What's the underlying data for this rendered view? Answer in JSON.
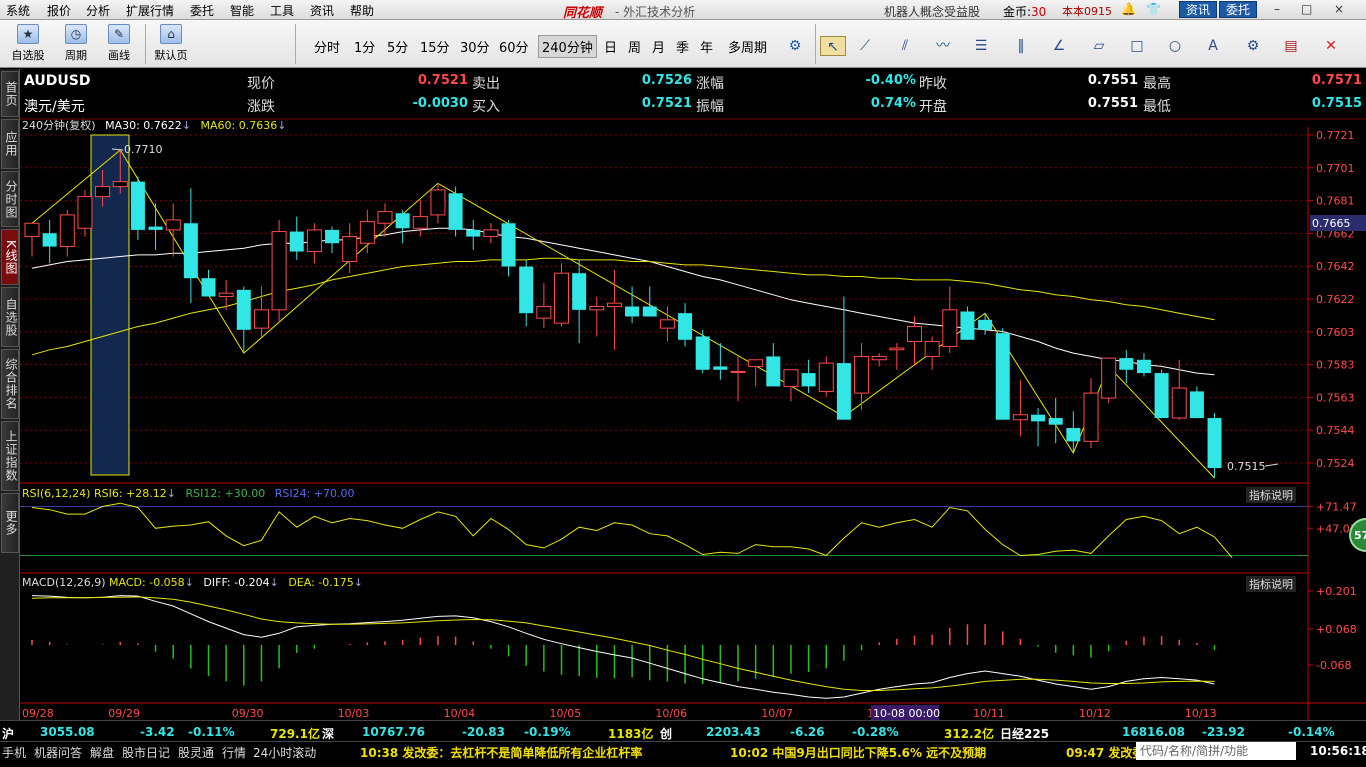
{
  "menu": {
    "items": [
      "系统",
      "报价",
      "分析",
      "扩展行情",
      "委托",
      "智能",
      "工具",
      "资讯",
      "帮助"
    ],
    "brand": "同花顺",
    "subtitle": "- 外汇技术分析",
    "promo": "机器人概念受益股",
    "coins_label": "金币:",
    "coins_value": "30",
    "user": "本本0915",
    "btn_news": "资讯",
    "btn_trade": "委托",
    "win_min": "–",
    "win_max": "□",
    "win_close": "×"
  },
  "toolbar": {
    "btn_watchlist": "自选股",
    "btn_cycle": "周期",
    "btn_draw": "画线",
    "btn_default": "默认页",
    "periods": [
      "分时",
      "1分",
      "5分",
      "15分",
      "30分",
      "60分",
      "240分钟",
      "日",
      "周",
      "月",
      "季",
      "年",
      "多周期"
    ],
    "active_period": "240分钟"
  },
  "sidetabs": [
    "首页",
    "应用",
    "分时图",
    "K线图",
    "自选股",
    "综合排名",
    "上证指数",
    "更多"
  ],
  "quote": {
    "symbol": "AUDUSD",
    "name": "澳元/美元",
    "now_label": "现价",
    "now": "0.7521",
    "sell_label": "卖出",
    "sell": "0.7526",
    "pct_label": "涨幅",
    "pct": "-0.40%",
    "prev_label": "昨收",
    "prev": "0.7551",
    "high_label": "最高",
    "high": "0.7571",
    "chg_label": "涨跌",
    "chg": "-0.0030",
    "buy_label": "买入",
    "buy": "0.7521",
    "amp_label": "振幅",
    "amp": "0.74%",
    "open_label": "开盘",
    "open": "0.7551",
    "low_label": "最低",
    "low": "0.7515"
  },
  "main_legend": {
    "period": "240分钟(复权)",
    "ma30": "MA30: 0.7622",
    "ma60": "MA60: 0.7636"
  },
  "rsi_legend": {
    "title": "RSI(6,12,24)",
    "rsi6": "RSI6: +28.12",
    "rsi12": "RSI12: +30.00",
    "rsi24": "RSI24: +70.00",
    "help": "指标说明"
  },
  "macd_legend": {
    "title": "MACD(12,26,9)",
    "macd": "MACD: -0.058",
    "diff": "DIFF: -0.204",
    "dea": "DEA: -0.175",
    "help": "指标说明"
  },
  "annotations": {
    "high_mark": "0.7710",
    "low_mark": "0.7515",
    "cursor_time": "10-08 00:00",
    "current_price": "0.7665",
    "badge": "57"
  },
  "status": {
    "sh_label": "沪",
    "sh_val": "3055.08",
    "sh_chg": "-3.42",
    "sh_pct": "-0.11%",
    "sh_amt": "729.1亿",
    "sz_label": "深",
    "sz_val": "10767.76",
    "sz_chg": "-20.83",
    "sz_pct": "-0.19%",
    "sz_amt": "1183亿",
    "cy_label": "创",
    "cy_val": "2203.43",
    "cy_chg": "-6.26",
    "cy_pct": "-0.28%",
    "cy_amt": "312.2亿",
    "nk_label": "日经225",
    "nk_val": "16816.08",
    "nk_chg": "-23.92",
    "nk_pct": "-0.14%"
  },
  "ticker": {
    "buttons": [
      "手机",
      "机器问答",
      "解盘",
      "股市日记",
      "股灵通",
      "行情",
      "24小时滚动"
    ],
    "news1": "10:38 发改委：去杠杆不是简单降低所有企业杠杆率",
    "news2": "10:02 中国9月出口同比下降5.6% 远不及预期",
    "news3": "09:47 发改委",
    "search_placeholder": "代码/名称/简拼/功能",
    "clock": "10:56:18"
  },
  "colors": {
    "up": "#ff4a4a",
    "down": "#33e6e6",
    "ma30": "#ffffff",
    "ma60": "#e6e600",
    "grid": "#7a0000",
    "highlight": "#13284d"
  },
  "chart_data": {
    "type": "candlestick",
    "symbol": "AUDUSD",
    "period": "240分钟",
    "price_axis": [
      "0.7721",
      "0.7701",
      "0.7681",
      "0.7662",
      "0.7642",
      "0.7622",
      "0.7603",
      "0.7583",
      "0.7563",
      "0.7544",
      "0.7524"
    ],
    "ylim": [
      0.7515,
      0.7721
    ],
    "date_labels": [
      "09/28",
      "09/29",
      "09/30",
      "10/03",
      "10/04",
      "10/05",
      "10/06",
      "10/07",
      "10/10",
      "10/11",
      "10/12",
      "10/13"
    ],
    "date_label_index": [
      0,
      5,
      12,
      18,
      24,
      30,
      36,
      42,
      48,
      54,
      60,
      66
    ],
    "candles": [
      {
        "o": 0.766,
        "h": 0.7668,
        "l": 0.7648,
        "c": 0.7668
      },
      {
        "o": 0.7662,
        "h": 0.767,
        "l": 0.7644,
        "c": 0.7654
      },
      {
        "o": 0.7654,
        "h": 0.7676,
        "l": 0.7648,
        "c": 0.7673
      },
      {
        "o": 0.7665,
        "h": 0.7688,
        "l": 0.766,
        "c": 0.7684
      },
      {
        "o": 0.7684,
        "h": 0.77,
        "l": 0.7678,
        "c": 0.769
      },
      {
        "o": 0.769,
        "h": 0.7712,
        "l": 0.7686,
        "c": 0.7693
      },
      {
        "o": 0.7693,
        "h": 0.7696,
        "l": 0.7658,
        "c": 0.7664
      },
      {
        "o": 0.7666,
        "h": 0.768,
        "l": 0.7652,
        "c": 0.7664
      },
      {
        "o": 0.7664,
        "h": 0.768,
        "l": 0.7648,
        "c": 0.767
      },
      {
        "o": 0.7668,
        "h": 0.7689,
        "l": 0.762,
        "c": 0.7635
      },
      {
        "o": 0.7635,
        "h": 0.764,
        "l": 0.7628,
        "c": 0.7624
      },
      {
        "o": 0.7624,
        "h": 0.7634,
        "l": 0.7616,
        "c": 0.7626
      },
      {
        "o": 0.7628,
        "h": 0.763,
        "l": 0.759,
        "c": 0.7604
      },
      {
        "o": 0.7605,
        "h": 0.763,
        "l": 0.76,
        "c": 0.7616
      },
      {
        "o": 0.7616,
        "h": 0.767,
        "l": 0.7608,
        "c": 0.7663
      },
      {
        "o": 0.7663,
        "h": 0.7672,
        "l": 0.7646,
        "c": 0.7651
      },
      {
        "o": 0.7651,
        "h": 0.7668,
        "l": 0.7644,
        "c": 0.7664
      },
      {
        "o": 0.7664,
        "h": 0.7666,
        "l": 0.765,
        "c": 0.7656
      },
      {
        "o": 0.7645,
        "h": 0.7668,
        "l": 0.7638,
        "c": 0.766
      },
      {
        "o": 0.7656,
        "h": 0.7676,
        "l": 0.765,
        "c": 0.7669
      },
      {
        "o": 0.7668,
        "h": 0.768,
        "l": 0.766,
        "c": 0.7675
      },
      {
        "o": 0.7674,
        "h": 0.7676,
        "l": 0.7656,
        "c": 0.7665
      },
      {
        "o": 0.7665,
        "h": 0.7682,
        "l": 0.766,
        "c": 0.7672
      },
      {
        "o": 0.7673,
        "h": 0.7692,
        "l": 0.7668,
        "c": 0.7688
      },
      {
        "o": 0.7686,
        "h": 0.769,
        "l": 0.766,
        "c": 0.7664
      },
      {
        "o": 0.7664,
        "h": 0.767,
        "l": 0.7652,
        "c": 0.766
      },
      {
        "o": 0.766,
        "h": 0.7668,
        "l": 0.7656,
        "c": 0.7664
      },
      {
        "o": 0.7668,
        "h": 0.767,
        "l": 0.7636,
        "c": 0.7642
      },
      {
        "o": 0.7642,
        "h": 0.7646,
        "l": 0.7606,
        "c": 0.7614
      },
      {
        "o": 0.7611,
        "h": 0.7632,
        "l": 0.7605,
        "c": 0.7618
      },
      {
        "o": 0.7608,
        "h": 0.7644,
        "l": 0.7606,
        "c": 0.7638
      },
      {
        "o": 0.7638,
        "h": 0.7646,
        "l": 0.7596,
        "c": 0.7616
      },
      {
        "o": 0.7616,
        "h": 0.7624,
        "l": 0.76,
        "c": 0.7618
      },
      {
        "o": 0.7618,
        "h": 0.764,
        "l": 0.7592,
        "c": 0.762
      },
      {
        "o": 0.7618,
        "h": 0.763,
        "l": 0.7608,
        "c": 0.7612
      },
      {
        "o": 0.7618,
        "h": 0.763,
        "l": 0.7612,
        "c": 0.7612
      },
      {
        "o": 0.7605,
        "h": 0.7618,
        "l": 0.7597,
        "c": 0.761
      },
      {
        "o": 0.7614,
        "h": 0.762,
        "l": 0.7594,
        "c": 0.7598
      },
      {
        "o": 0.76,
        "h": 0.7604,
        "l": 0.7578,
        "c": 0.758
      },
      {
        "o": 0.7582,
        "h": 0.7596,
        "l": 0.7574,
        "c": 0.758
      },
      {
        "o": 0.7579,
        "h": 0.7588,
        "l": 0.7561,
        "c": 0.7579
      },
      {
        "o": 0.7582,
        "h": 0.7584,
        "l": 0.757,
        "c": 0.7586
      },
      {
        "o": 0.7588,
        "h": 0.7596,
        "l": 0.7572,
        "c": 0.757
      },
      {
        "o": 0.757,
        "h": 0.758,
        "l": 0.7561,
        "c": 0.758
      },
      {
        "o": 0.7578,
        "h": 0.7586,
        "l": 0.7566,
        "c": 0.757
      },
      {
        "o": 0.7567,
        "h": 0.7588,
        "l": 0.7564,
        "c": 0.7584
      },
      {
        "o": 0.7584,
        "h": 0.7624,
        "l": 0.7552,
        "c": 0.755
      },
      {
        "o": 0.7566,
        "h": 0.7596,
        "l": 0.7556,
        "c": 0.7588
      },
      {
        "o": 0.7586,
        "h": 0.759,
        "l": 0.7582,
        "c": 0.7588
      },
      {
        "o": 0.7592,
        "h": 0.7596,
        "l": 0.758,
        "c": 0.7593
      },
      {
        "o": 0.7597,
        "h": 0.7612,
        "l": 0.7583,
        "c": 0.7606
      },
      {
        "o": 0.7588,
        "h": 0.76,
        "l": 0.758,
        "c": 0.7597
      },
      {
        "o": 0.7594,
        "h": 0.763,
        "l": 0.759,
        "c": 0.7616
      },
      {
        "o": 0.7615,
        "h": 0.7618,
        "l": 0.7598,
        "c": 0.7598
      },
      {
        "o": 0.761,
        "h": 0.7614,
        "l": 0.7601,
        "c": 0.7604
      },
      {
        "o": 0.7602,
        "h": 0.7605,
        "l": 0.755,
        "c": 0.755
      },
      {
        "o": 0.755,
        "h": 0.7574,
        "l": 0.754,
        "c": 0.7553
      },
      {
        "o": 0.7553,
        "h": 0.7557,
        "l": 0.7534,
        "c": 0.7549
      },
      {
        "o": 0.7551,
        "h": 0.7563,
        "l": 0.7536,
        "c": 0.7547
      },
      {
        "o": 0.7545,
        "h": 0.7555,
        "l": 0.753,
        "c": 0.7537
      },
      {
        "o": 0.7537,
        "h": 0.7575,
        "l": 0.7533,
        "c": 0.7566
      },
      {
        "o": 0.7563,
        "h": 0.7582,
        "l": 0.756,
        "c": 0.7587
      },
      {
        "o": 0.7587,
        "h": 0.7592,
        "l": 0.7572,
        "c": 0.758
      },
      {
        "o": 0.7586,
        "h": 0.759,
        "l": 0.7576,
        "c": 0.7578
      },
      {
        "o": 0.7578,
        "h": 0.758,
        "l": 0.7551,
        "c": 0.7551
      },
      {
        "o": 0.7551,
        "h": 0.7586,
        "l": 0.755,
        "c": 0.7569
      },
      {
        "o": 0.7567,
        "h": 0.757,
        "l": 0.7552,
        "c": 0.7551
      },
      {
        "o": 0.7551,
        "h": 0.7554,
        "l": 0.7515,
        "c": 0.7521
      }
    ],
    "ma30": [
      0.7641,
      0.7643,
      0.7645,
      0.7646,
      0.7647,
      0.7648,
      0.7649,
      0.7649,
      0.765,
      0.765,
      0.7651,
      0.7652,
      0.7653,
      0.7655,
      0.7656,
      0.7656,
      0.7657,
      0.7658,
      0.7658,
      0.766,
      0.7661,
      0.7663,
      0.7664,
      0.7665,
      0.7665,
      0.7664,
      0.7662,
      0.766,
      0.7659,
      0.7657,
      0.7655,
      0.7653,
      0.7651,
      0.7649,
      0.7647,
      0.7645,
      0.7642,
      0.7639,
      0.7636,
      0.7634,
      0.7631,
      0.7628,
      0.7625,
      0.7622,
      0.762,
      0.7618,
      0.7616,
      0.7614,
      0.7612,
      0.761,
      0.7608,
      0.7607,
      0.7606,
      0.7605,
      0.7604,
      0.7603,
      0.76,
      0.7597,
      0.7593,
      0.759,
      0.7588,
      0.7586,
      0.7585,
      0.7583,
      0.7582,
      0.758,
      0.7578,
      0.7577
    ],
    "ma60": [
      0.7589,
      0.7592,
      0.7594,
      0.7597,
      0.76,
      0.7603,
      0.7606,
      0.7608,
      0.7611,
      0.7614,
      0.7616,
      0.7618,
      0.7621,
      0.7624,
      0.7627,
      0.7629,
      0.7631,
      0.7634,
      0.7636,
      0.7638,
      0.764,
      0.7642,
      0.7643,
      0.7644,
      0.7645,
      0.7645,
      0.7646,
      0.7646,
      0.7646,
      0.7647,
      0.7647,
      0.7646,
      0.7646,
      0.7646,
      0.7645,
      0.7645,
      0.7644,
      0.7643,
      0.7643,
      0.7642,
      0.7641,
      0.764,
      0.7639,
      0.7638,
      0.7637,
      0.7637,
      0.7636,
      0.7636,
      0.7635,
      0.7635,
      0.7634,
      0.7634,
      0.7634,
      0.7633,
      0.7632,
      0.763,
      0.7628,
      0.7627,
      0.7625,
      0.7624,
      0.7622,
      0.7621,
      0.7619,
      0.7618,
      0.7616,
      0.7614,
      0.7612,
      0.761
    ],
    "rsi_axis": [
      "+71.47",
      "+47.07"
    ],
    "rsi6": [
      74,
      72,
      68,
      68,
      75,
      78,
      74,
      55,
      57,
      58,
      61,
      48,
      39,
      44,
      70,
      56,
      66,
      60,
      64,
      62,
      58,
      55,
      63,
      70,
      66,
      48,
      64,
      54,
      40,
      37,
      45,
      56,
      53,
      60,
      58,
      50,
      48,
      40,
      31,
      33,
      32,
      40,
      38,
      38,
      36,
      30,
      46,
      60,
      56,
      60,
      63,
      56,
      74,
      71,
      54,
      40,
      30,
      31,
      34,
      35,
      32,
      48,
      63,
      66,
      62,
      50,
      56,
      47,
      28
    ],
    "macd_axis": [
      "+0.201",
      "+0.068",
      "-0.068"
    ],
    "diff": [
      0.19,
      0.188,
      0.183,
      0.182,
      0.184,
      0.19,
      0.188,
      0.168,
      0.15,
      0.12,
      0.09,
      0.065,
      0.04,
      0.03,
      0.045,
      0.07,
      0.075,
      0.08,
      0.082,
      0.086,
      0.09,
      0.095,
      0.103,
      0.11,
      0.112,
      0.105,
      0.09,
      0.07,
      0.045,
      0.022,
      0.005,
      -0.01,
      -0.025,
      -0.038,
      -0.05,
      -0.07,
      -0.09,
      -0.11,
      -0.13,
      -0.145,
      -0.16,
      -0.17,
      -0.182,
      -0.19,
      -0.2,
      -0.205,
      -0.2,
      -0.185,
      -0.17,
      -0.16,
      -0.15,
      -0.145,
      -0.125,
      -0.11,
      -0.1,
      -0.11,
      -0.12,
      -0.135,
      -0.15,
      -0.16,
      -0.17,
      -0.16,
      -0.14,
      -0.13,
      -0.125,
      -0.13,
      -0.135,
      -0.15
    ],
    "dea": [
      0.18,
      0.182,
      0.182,
      0.182,
      0.183,
      0.184,
      0.185,
      0.181,
      0.176,
      0.165,
      0.15,
      0.135,
      0.118,
      0.1,
      0.09,
      0.085,
      0.082,
      0.08,
      0.08,
      0.081,
      0.083,
      0.085,
      0.089,
      0.093,
      0.096,
      0.098,
      0.097,
      0.092,
      0.085,
      0.073,
      0.062,
      0.05,
      0.038,
      0.026,
      0.012,
      -0.002,
      -0.02,
      -0.036,
      -0.055,
      -0.072,
      -0.09,
      -0.105,
      -0.12,
      -0.135,
      -0.148,
      -0.16,
      -0.17,
      -0.175,
      -0.175,
      -0.172,
      -0.168,
      -0.165,
      -0.158,
      -0.15,
      -0.14,
      -0.136,
      -0.132,
      -0.132,
      -0.135,
      -0.14,
      -0.146,
      -0.148,
      -0.148,
      -0.146,
      -0.142,
      -0.14,
      -0.139,
      -0.14
    ]
  }
}
